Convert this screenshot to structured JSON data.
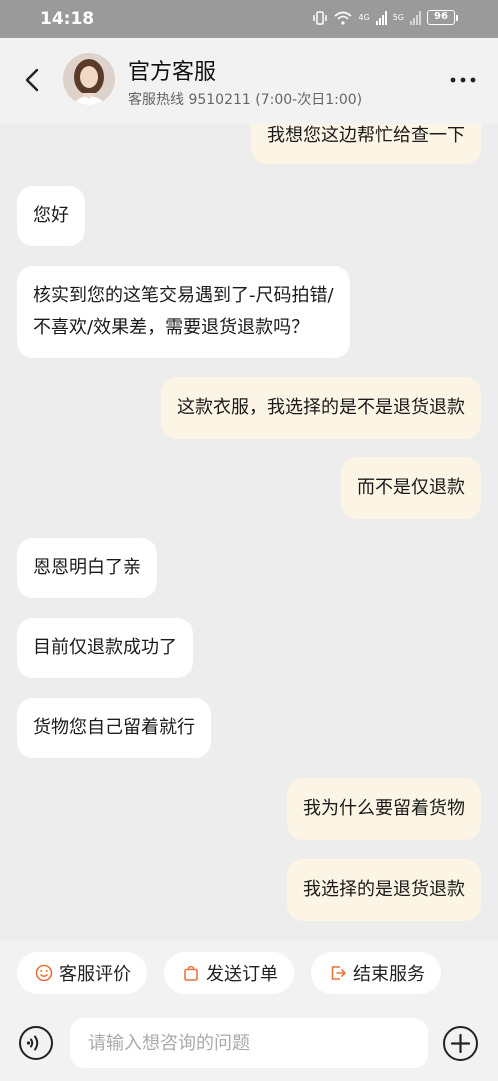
{
  "status": {
    "time": "14:18",
    "net_label_1": "4G",
    "net_label_2": "5G",
    "battery": "96"
  },
  "header": {
    "title": "官方客服",
    "subtitle": "客服热线 9510211 (7:00-次日1:00)"
  },
  "messages": [
    {
      "side": "out",
      "text": "我想您这边帮忙给查一下"
    },
    {
      "side": "in",
      "text": "您好"
    },
    {
      "side": "in",
      "line1": "核实到您的这笔交易遇到了-尺码拍错/",
      "line2": "不喜欢/效果差，需要退货退款吗？"
    },
    {
      "side": "out",
      "text": "这款衣服，我选择的是不是退货退款"
    },
    {
      "side": "out",
      "text": "而不是仅退款"
    },
    {
      "side": "in",
      "text": "恩恩明白了亲"
    },
    {
      "side": "in",
      "text": "目前仅退款成功了"
    },
    {
      "side": "in",
      "text": "货物您自己留着就行"
    },
    {
      "side": "out",
      "text": "我为什么要留着货物"
    },
    {
      "side": "out",
      "text": "我选择的是退货退款"
    }
  ],
  "quick_actions": {
    "rate": "客服评价",
    "send_order": "发送订单",
    "end_service": "结束服务"
  },
  "input": {
    "placeholder": "请输入想咨询的问题"
  },
  "colors": {
    "accent": "#e8743b",
    "bubble_out": "#fcf5e6",
    "bubble_in": "#ffffff",
    "background": "#ededed"
  }
}
